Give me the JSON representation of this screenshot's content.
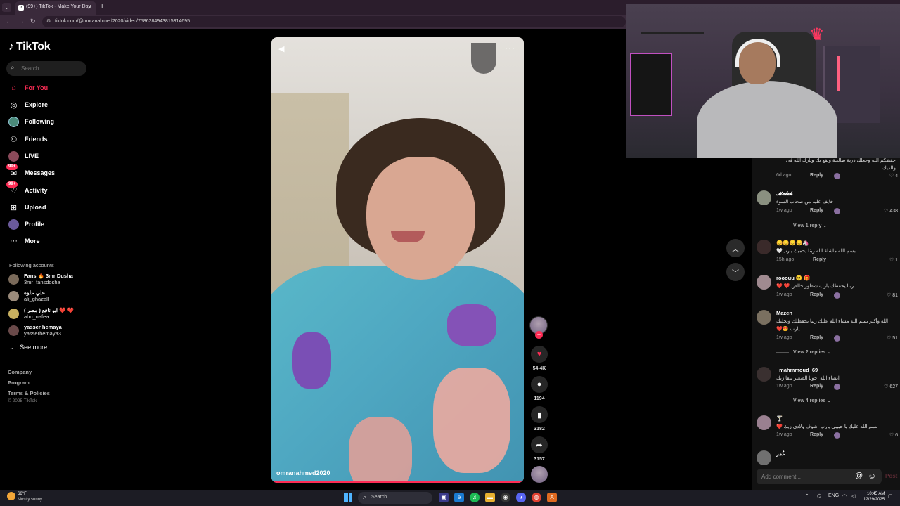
{
  "browser": {
    "tab_title": "(99+) TikTok - Make Your Day",
    "url": "tiktok.com/@omranahmed2020/video/7586284943815314695"
  },
  "brand": {
    "logo_text": "TikTok"
  },
  "search": {
    "placeholder": "Search"
  },
  "nav": [
    {
      "label": "For You",
      "icon": "home-icon",
      "active": true
    },
    {
      "label": "Explore",
      "icon": "compass-icon"
    },
    {
      "label": "Following",
      "icon": "following-icon"
    },
    {
      "label": "Friends",
      "icon": "friends-icon"
    },
    {
      "label": "LIVE",
      "icon": "live-icon"
    },
    {
      "label": "Messages",
      "icon": "messages-icon",
      "badge": "99+"
    },
    {
      "label": "Activity",
      "icon": "activity-icon",
      "badge": "99+"
    },
    {
      "label": "Upload",
      "icon": "upload-icon"
    },
    {
      "label": "Profile",
      "icon": "profile-icon"
    },
    {
      "label": "More",
      "icon": "more-icon"
    }
  ],
  "following_accounts": {
    "title": "Following accounts",
    "accounts": [
      {
        "name": "Fans 🔥 3mr Dusha",
        "username": "3mr_fansdosha"
      },
      {
        "name": "علي علوه",
        "username": "ali_ghazall"
      },
      {
        "name": "ابو نافع ( مصر ) ❤️ ❤️",
        "username": "abo_nafea"
      },
      {
        "name": "yasser hemaya",
        "username": "yasserhemaya3"
      }
    ],
    "see_more": "See more"
  },
  "footer": {
    "links": [
      "Company",
      "Program",
      "Terms & Policies"
    ],
    "copyright": "© 2025 TikTok"
  },
  "video": {
    "author": "omranahmed2020",
    "progress": 1.0
  },
  "actions": {
    "likes": "54.4K",
    "comments": "1194",
    "saves": "3182",
    "shares": "3157"
  },
  "comments": {
    "top_text": "حفظكم الله وجعلك ذرية صالحة ونفع بك وبارك الله فى والديك",
    "top_meta": {
      "time": "6d ago",
      "reply": "Reply",
      "likes": "4"
    },
    "items": [
      {
        "name": "𝓜𝓪𝓵𝓮𝓴",
        "text": "خايف عليه من صحاب السوء",
        "time": "1w ago",
        "reply": "Reply",
        "likes": "438",
        "view_replies": "View 1 reply"
      },
      {
        "name": "😊😊😊😊🦄",
        "text": "بسم الله ماشاء الله ربنا يحميك يارب🤍",
        "time": "15h ago",
        "reply": "Reply",
        "likes": "1"
      },
      {
        "name": "rooouu 🙂 🎁",
        "text": "ربنا يحفظك يارب شطور خالص ❤️ ❤️",
        "time": "1w ago",
        "reply": "Reply",
        "likes": "81"
      },
      {
        "name": "Mazen",
        "text": "الله وأكبر بسم الله مشاء الله عليك ربنا يحفظلك ويخليك يارب 😍❤️",
        "time": "1w ago",
        "reply": "Reply",
        "likes": "51",
        "view_replies": "View 2 replies"
      },
      {
        "name": "_mahmmoud_69_",
        "text": "انشاء الله اخويا الصغير بيقا زيك",
        "time": "1w ago",
        "reply": "Reply",
        "likes": "627",
        "view_replies": "View 4 replies"
      },
      {
        "name": "🍸",
        "text": "بسم الله عليك يا حبيبي يارب اشوف ولادي زيك ❤️",
        "time": "1w ago",
        "reply": "Reply",
        "likes": "6"
      },
      {
        "name": "عُمر",
        "text": "",
        "time": "",
        "reply": "",
        "likes": ""
      }
    ],
    "add_placeholder": "Add comment...",
    "post_label": "Post"
  },
  "taskbar": {
    "weather_temp": "66°F",
    "weather_desc": "Mostly sunny",
    "search_label": "Search",
    "language": "ENG",
    "time": "10:45 AM",
    "date": "12/29/2025"
  },
  "colors": {
    "accent": "#fe2c55",
    "background": "#000000",
    "panel": "#121212"
  }
}
